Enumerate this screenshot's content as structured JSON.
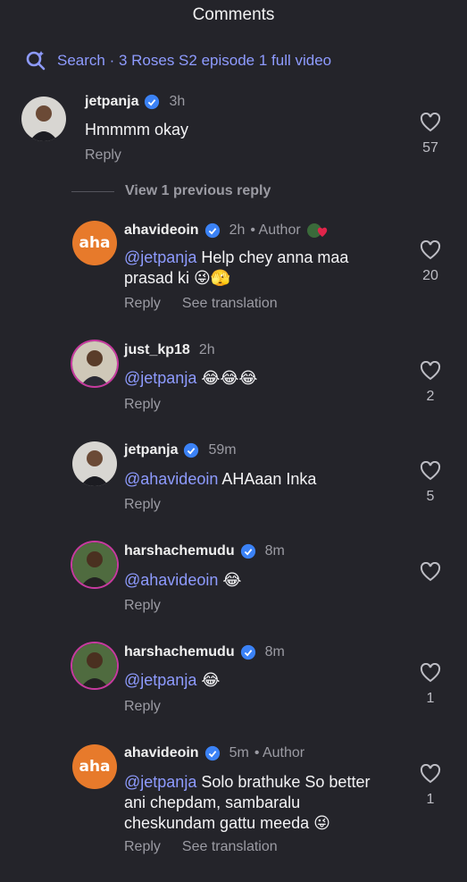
{
  "header": {
    "title": "Comments"
  },
  "search": {
    "text": "Search · 3 Roses S2 episode 1 full video"
  },
  "view_previous": "View 1 previous reply",
  "comments": [
    {
      "user": "jetpanja",
      "verified": true,
      "time": "3h",
      "author": "",
      "mention": "",
      "text": "Hmmmm okay",
      "actions": [
        "Reply"
      ],
      "likes": "57"
    },
    {
      "user": "ahavideoin",
      "verified": true,
      "time": "2h",
      "author": "• Author",
      "mention": "@jetpanja",
      "text": " Help chey anna maa prasad ki 😜🫣",
      "actions": [
        "Reply",
        "See translation"
      ],
      "likes": "20"
    },
    {
      "user": "just_kp18",
      "verified": false,
      "time": "2h",
      "author": "",
      "mention": "@jetpanja",
      "text": " 😂😂😂",
      "actions": [
        "Reply"
      ],
      "likes": "2"
    },
    {
      "user": "jetpanja",
      "verified": true,
      "time": "59m",
      "author": "",
      "mention": "@ahavideoin",
      "text": " AHAaan Inka",
      "actions": [
        "Reply"
      ],
      "likes": "5"
    },
    {
      "user": "harshachemudu",
      "verified": true,
      "time": "8m",
      "author": "",
      "mention": "@ahavideoin",
      "text": " 😂",
      "actions": [
        "Reply"
      ],
      "likes": ""
    },
    {
      "user": "harshachemudu",
      "verified": true,
      "time": "8m",
      "author": "",
      "mention": "@jetpanja",
      "text": " 😂",
      "actions": [
        "Reply"
      ],
      "likes": "1"
    },
    {
      "user": "ahavideoin",
      "verified": true,
      "time": "5m",
      "author": "• Author",
      "mention": "@jetpanja",
      "text": " Solo brathuke So better ani chepdam, sambaralu cheskundam gattu meeda 😜",
      "actions": [
        "Reply",
        "See translation"
      ],
      "likes": "1"
    }
  ],
  "aha_logo": "aha",
  "colors": {
    "bg": "#24242a",
    "accent": "#8e9bff",
    "verified": "#3b82f6",
    "muted": "#9b9ba3"
  }
}
